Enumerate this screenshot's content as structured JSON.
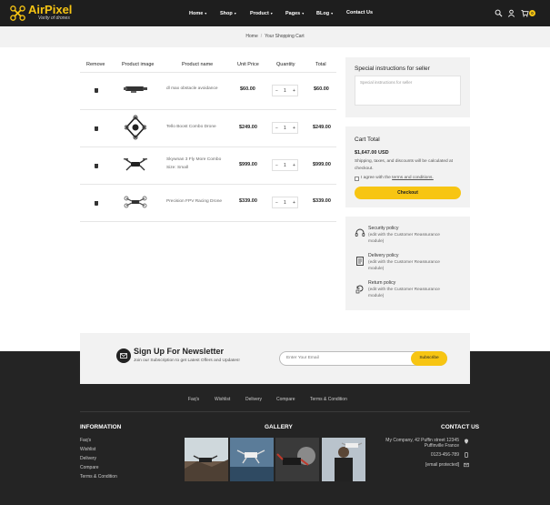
{
  "brand": {
    "name": "AirPixel",
    "tagline": "Varity of drones"
  },
  "colors": {
    "accent": "#f7c513",
    "header_bg": "#1e1e1e",
    "footer_bg": "#242424"
  },
  "nav": {
    "items": [
      {
        "label": "Home"
      },
      {
        "label": "Shop"
      },
      {
        "label": "Product"
      },
      {
        "label": "Pages"
      },
      {
        "label": "BLog"
      },
      {
        "label": "Contact Us"
      }
    ],
    "cart_count": "0"
  },
  "breadcrumb": {
    "home": "Home",
    "current": "Your Shopping Cart"
  },
  "cart": {
    "headers": {
      "remove": "Remove",
      "image": "Product image",
      "name": "Product name",
      "unit": "Unit Price",
      "qty": "Quantity",
      "total": "Total"
    },
    "rows": [
      {
        "name": "dl max obstacle avoidance",
        "variant": "",
        "unit": "$60.00",
        "qty": "1",
        "total": "$60.00"
      },
      {
        "name": "Tello Boost Combo Drone",
        "variant": "",
        "unit": "$249.00",
        "qty": "1",
        "total": "$249.00"
      },
      {
        "name": "Skywnan 3 Fly More Combo",
        "variant": "Size: Small",
        "unit": "$999.00",
        "qty": "1",
        "total": "$999.00"
      },
      {
        "name": "Precision FPV Racing Drone",
        "variant": "",
        "unit": "$339.00",
        "qty": "1",
        "total": "$339.00"
      }
    ]
  },
  "instructions": {
    "title": "Special instructions for seller",
    "placeholder": "Special instructions for seller"
  },
  "totals": {
    "title": "Cart Total",
    "amount": "$1,647.00 USD",
    "note": "Shipping, taxes, and discounts will be calculated at checkout.",
    "agree_prefix": "I agree with the",
    "agree_link": "terms and conditions.",
    "checkout": "Checkout"
  },
  "reassurance": [
    {
      "icon": "headset-icon",
      "title": "Security policy",
      "desc": "(edit with the Customer Reassurance module)"
    },
    {
      "icon": "truck-icon",
      "title": "Delivery policy",
      "desc": "(edit with the Customer Reassurance module)"
    },
    {
      "icon": "return-icon",
      "title": "Return policy",
      "desc": "(edit with the Customer Reassurance module)"
    }
  ],
  "newsletter": {
    "title": "Sign Up For Newsletter",
    "subtitle": "Join our Subscription to get Latest Offers and Updates!",
    "placeholder": "Enter Your Email",
    "button": "Subscribe"
  },
  "footer": {
    "links": [
      "Faq's",
      "Wishlist",
      "Delivery",
      "Compare",
      "Terms & Condition"
    ],
    "info_title": "INFORMATION",
    "info_items": [
      "Faq's",
      "Wishlist",
      "Delivery",
      "Compare",
      "Terms & Condition"
    ],
    "gallery_title": "GALLERY",
    "contact_title": "CONTACT US",
    "address_line1": "My Company, 42 Puffin street 12345",
    "address_line2": "Puffinville France",
    "phone": "0123-456-789",
    "email": "[email protected]"
  }
}
